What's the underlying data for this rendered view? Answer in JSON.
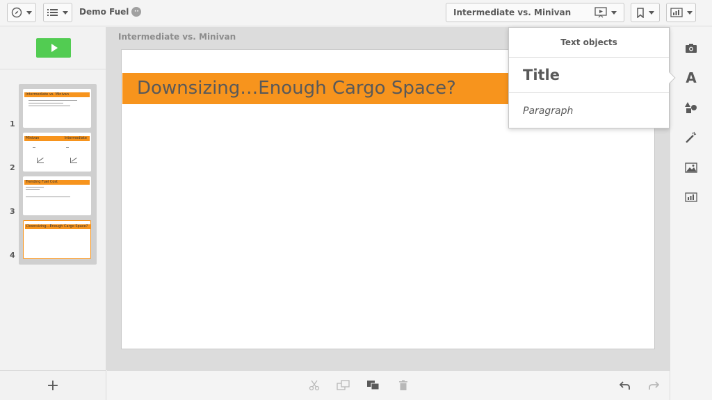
{
  "toolbar": {
    "app_name": "Demo Fuel",
    "story_title": "Intermediate vs. Minivan"
  },
  "left_panel": {
    "add_label": "+",
    "slides": [
      {
        "number": "1",
        "title": "Intermediate vs. Minivan"
      },
      {
        "number": "2",
        "title": "Minivan",
        "title2": "Intermediate"
      },
      {
        "number": "3",
        "title": "Trending Fuel Cost"
      },
      {
        "number": "4",
        "title": "Downsizing…Enough Cargo Space?"
      }
    ]
  },
  "main": {
    "sheet_label": "Intermediate vs. Minivan",
    "slide_title": "Downsizing…Enough Cargo Space?"
  },
  "popover": {
    "header": "Text objects",
    "title_item": "Title",
    "paragraph_item": "Paragraph"
  },
  "colors": {
    "accent": "#f7941d",
    "play": "#52cc52"
  }
}
